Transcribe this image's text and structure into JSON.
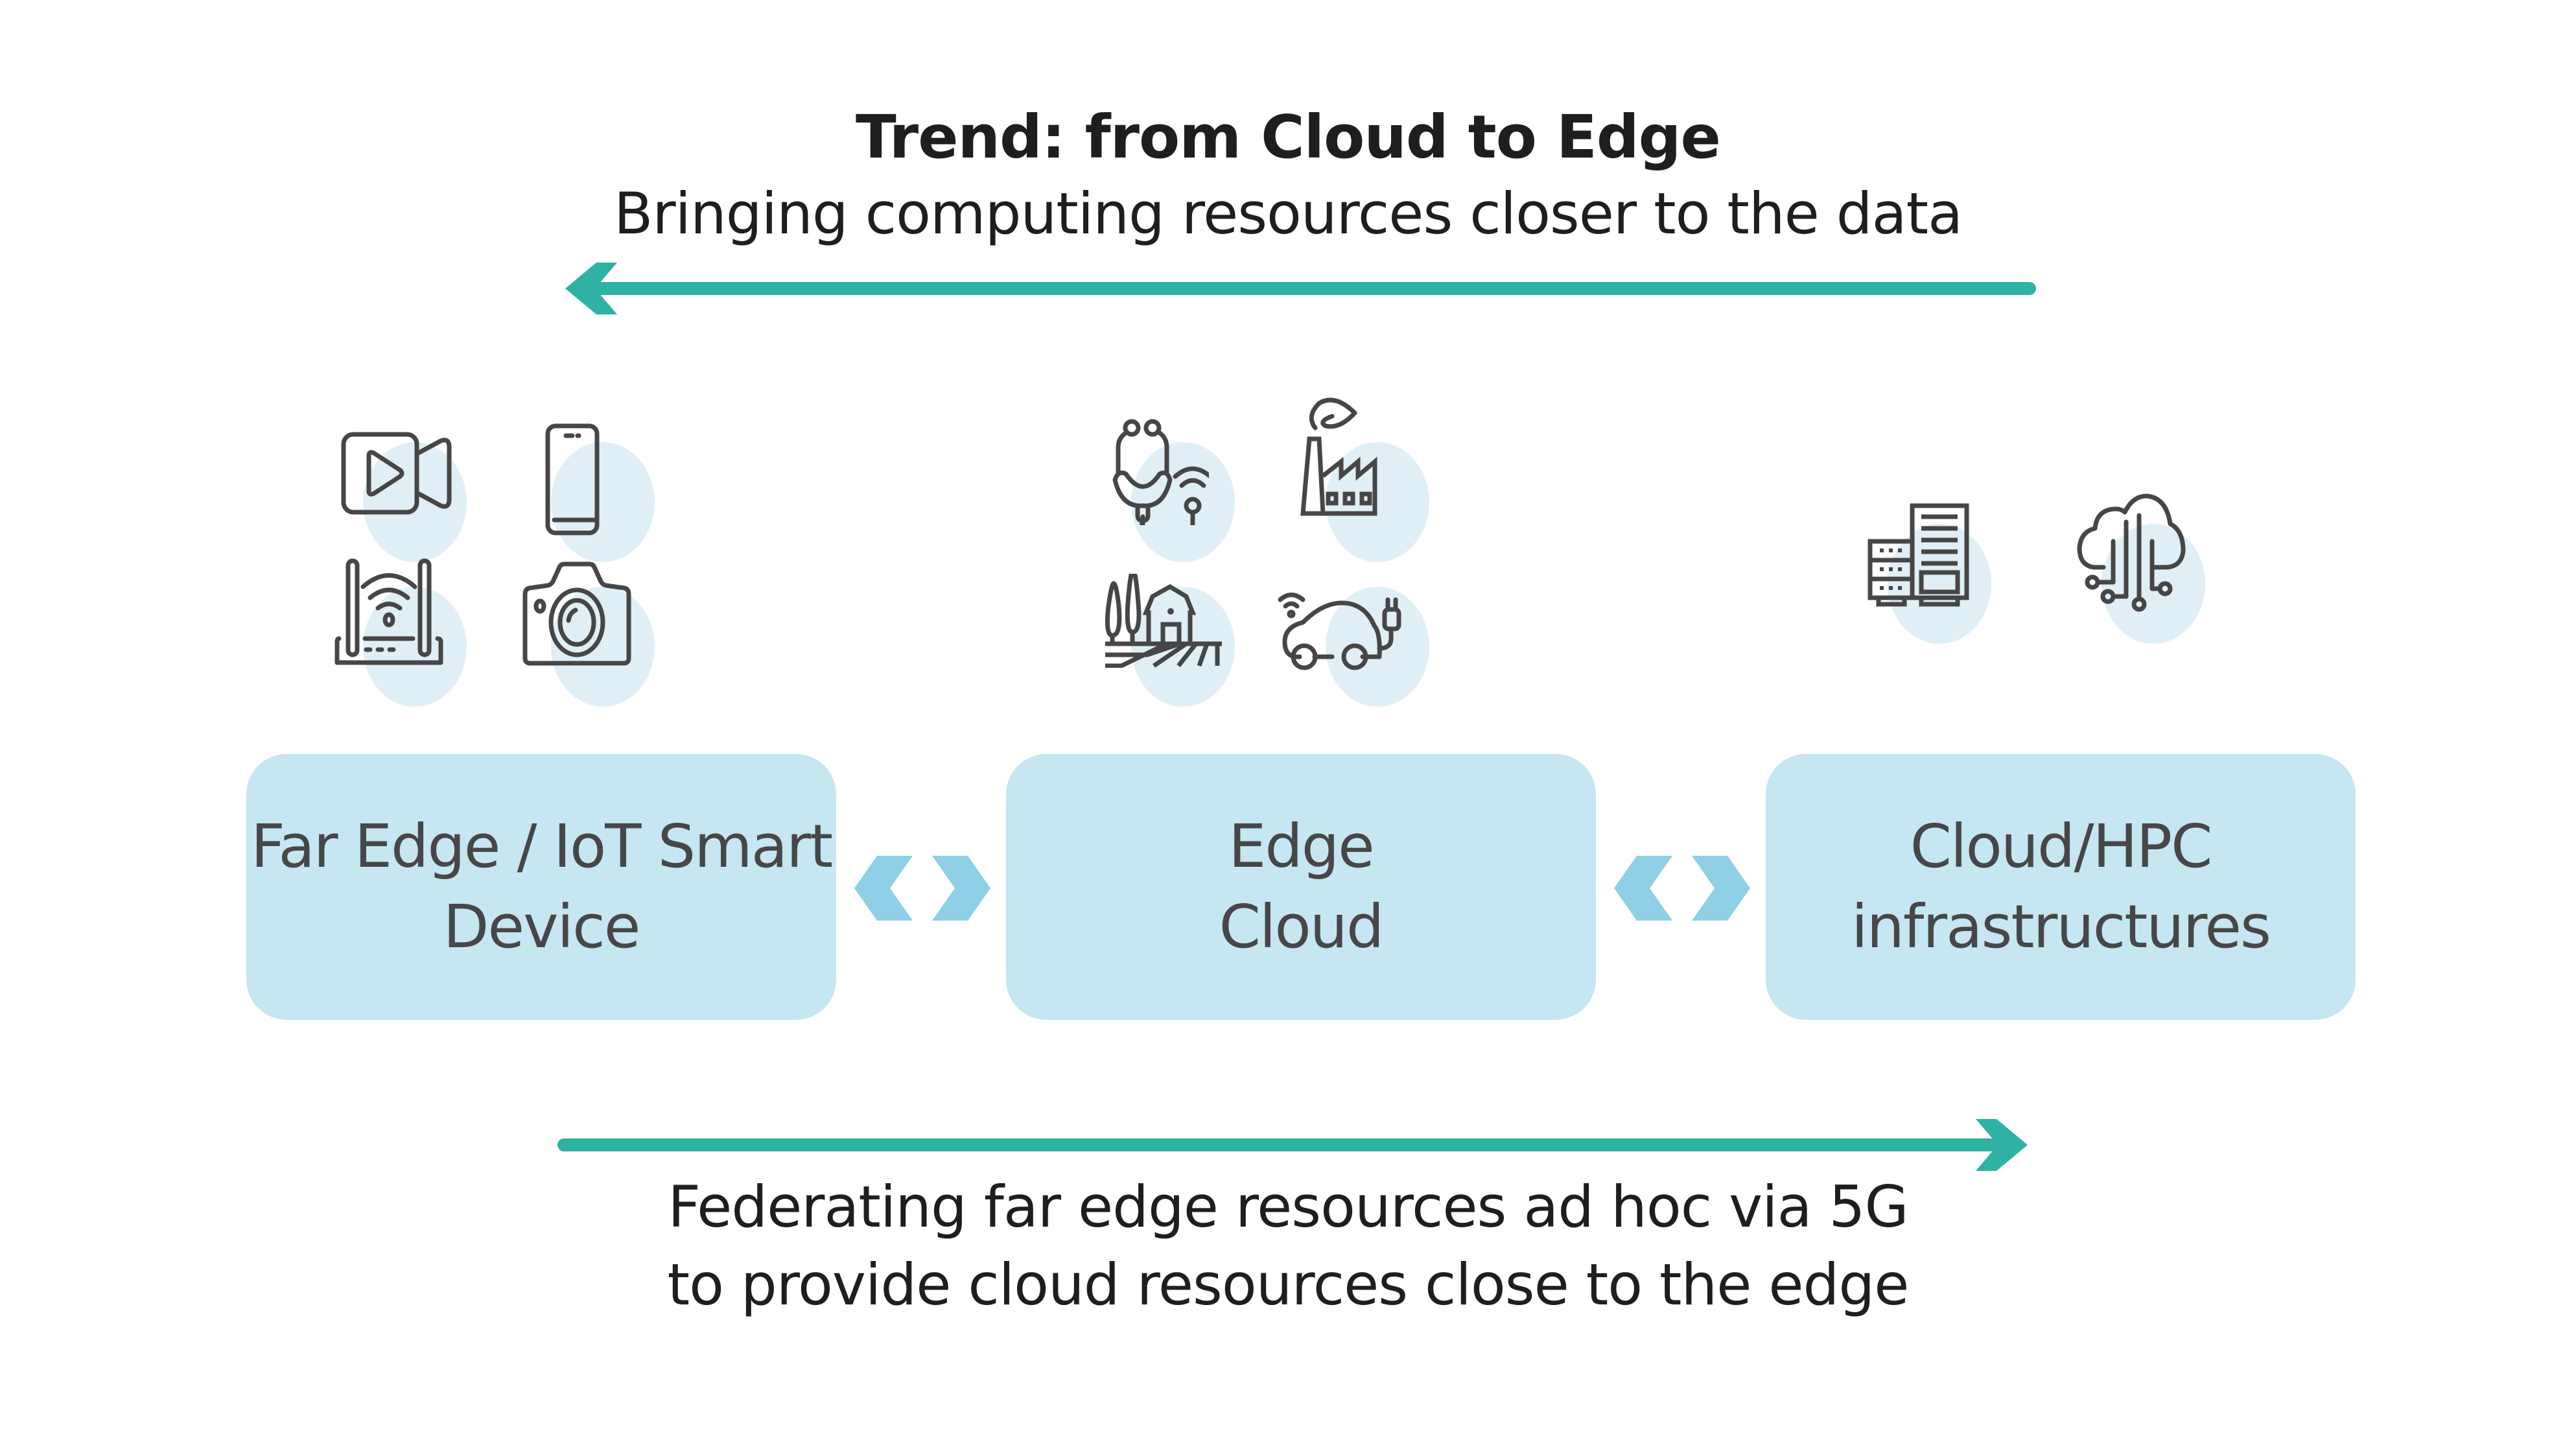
{
  "header": {
    "title": "Trend: from Cloud to Edge",
    "subtitle": "Bringing computing resources closer to the data"
  },
  "colors": {
    "arrow": "#2eb2a3",
    "box_fill": "#c6e6f1",
    "chevron": "#8fd0e6",
    "icon_blob": "#dfeff5",
    "icon_stroke": "#464646",
    "box_text": "#474747",
    "text": "#1e1e1e"
  },
  "top_arrow": {
    "direction": "left"
  },
  "bottom_arrow": {
    "direction": "right"
  },
  "columns": [
    {
      "label_lines": [
        "Far Edge / IoT Smart",
        "Device"
      ],
      "icons": [
        "video-camera-icon",
        "smartphone-icon",
        "wifi-router-icon",
        "photo-camera-icon"
      ]
    },
    {
      "label_lines": [
        "Edge",
        "Cloud"
      ],
      "icons": [
        "stethoscope-wifi-icon",
        "eco-factory-icon",
        "farm-icon",
        "connected-electric-car-icon"
      ]
    },
    {
      "label_lines": [
        "Cloud/HPC",
        "infrastructures"
      ],
      "icons": [
        "server-rack-icon",
        "cloud-circuit-icon"
      ]
    }
  ],
  "connectors": [
    "bidirectional-chevron-icon",
    "bidirectional-chevron-icon"
  ],
  "footer": {
    "line1": "Federating far edge resources ad hoc via 5G",
    "line2": "to provide cloud resources close to the edge"
  }
}
